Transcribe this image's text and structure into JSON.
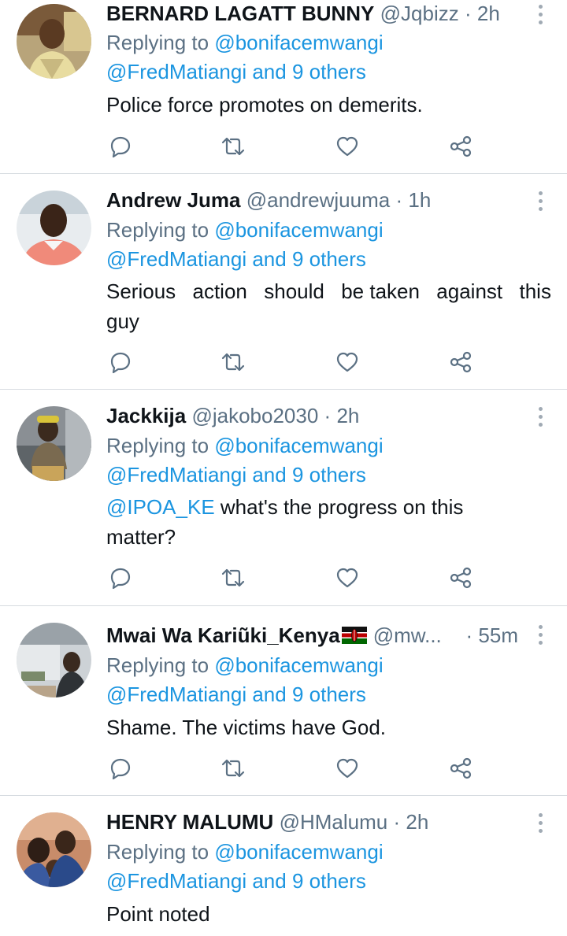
{
  "common": {
    "replying_label": "Replying to",
    "reply_target": "@bonifacemwangi",
    "second_mention": "@FredMatiangi and 9 others",
    "dot": "·"
  },
  "tweets": [
    {
      "name": "BERNARD LAGATT BUNNY",
      "handle": "@Jqbizz",
      "time": "2h",
      "text_lines": [
        "Police force promotes on demerits."
      ]
    },
    {
      "name": "Andrew Juma",
      "handle": "@andrewjuuma",
      "time": "1h",
      "text_words": [
        "Serious",
        "action",
        "should",
        "be taken",
        "against",
        "this"
      ],
      "text_line2": "guy"
    },
    {
      "name": "Jackkija",
      "handle": "@jakobo2030",
      "time": "2h",
      "mention": "@IPOA_KE",
      "text_line1": " what's the progress on this",
      "text_line2": "matter?"
    },
    {
      "name": "Mwai Wa Kariũki_Kenya",
      "flag": "kenya-flag",
      "handle": "@mw...",
      "time": "55m",
      "text_lines": [
        "Shame. The victims have God."
      ]
    },
    {
      "name": "HENRY MALUMU",
      "handle": "@HMalumu",
      "time": "2h",
      "text_lines": [
        "Point noted"
      ]
    }
  ],
  "icons": {
    "reply": "reply-icon",
    "retweet": "retweet-icon",
    "like": "like-icon",
    "share": "share-icon",
    "more": "more-options-icon"
  },
  "colors": {
    "link": "#1b95e0",
    "secondary": "#5b7083",
    "divider": "#d6dbe0"
  }
}
